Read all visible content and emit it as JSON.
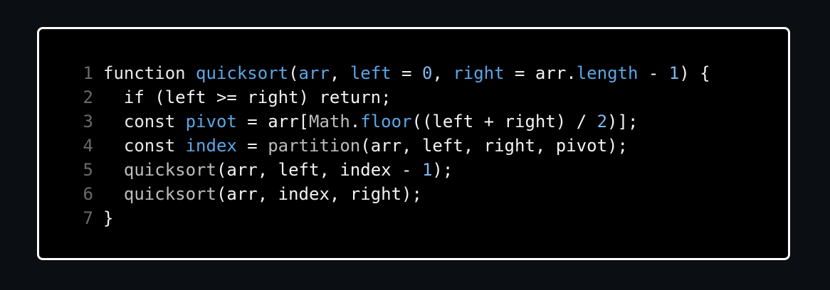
{
  "code_block": {
    "lines": [
      {
        "number": "1",
        "tokens": [
          {
            "text": "function ",
            "kind": "keyword"
          },
          {
            "text": "quicksort",
            "kind": "function"
          },
          {
            "text": "(",
            "kind": "plain"
          },
          {
            "text": "arr",
            "kind": "function"
          },
          {
            "text": ", ",
            "kind": "plain"
          },
          {
            "text": "left",
            "kind": "function"
          },
          {
            "text": " = ",
            "kind": "plain"
          },
          {
            "text": "0",
            "kind": "number"
          },
          {
            "text": ", ",
            "kind": "plain"
          },
          {
            "text": "right",
            "kind": "function"
          },
          {
            "text": " = arr.",
            "kind": "plain"
          },
          {
            "text": "length",
            "kind": "function"
          },
          {
            "text": " - ",
            "kind": "plain"
          },
          {
            "text": "1",
            "kind": "number"
          },
          {
            "text": ") {",
            "kind": "plain"
          }
        ]
      },
      {
        "number": "2",
        "tokens": [
          {
            "text": "  if (left >= right) return;",
            "kind": "plain"
          }
        ]
      },
      {
        "number": "3",
        "tokens": [
          {
            "text": "  const ",
            "kind": "keyword"
          },
          {
            "text": "pivot",
            "kind": "function"
          },
          {
            "text": " = arr[",
            "kind": "plain"
          },
          {
            "text": "Math",
            "kind": "muted"
          },
          {
            "text": ".",
            "kind": "plain"
          },
          {
            "text": "floor",
            "kind": "function"
          },
          {
            "text": "((left + right) / ",
            "kind": "plain"
          },
          {
            "text": "2",
            "kind": "number"
          },
          {
            "text": ")];",
            "kind": "plain"
          }
        ]
      },
      {
        "number": "4",
        "tokens": [
          {
            "text": "  const ",
            "kind": "keyword"
          },
          {
            "text": "index",
            "kind": "function"
          },
          {
            "text": " = ",
            "kind": "plain"
          },
          {
            "text": "partition",
            "kind": "muted"
          },
          {
            "text": "(arr, left, right, pivot);",
            "kind": "plain"
          }
        ]
      },
      {
        "number": "5",
        "tokens": [
          {
            "text": "  ",
            "kind": "plain"
          },
          {
            "text": "quicksort",
            "kind": "muted"
          },
          {
            "text": "(arr, left, index - ",
            "kind": "plain"
          },
          {
            "text": "1",
            "kind": "number"
          },
          {
            "text": ");",
            "kind": "plain"
          }
        ]
      },
      {
        "number": "6",
        "tokens": [
          {
            "text": "  ",
            "kind": "plain"
          },
          {
            "text": "quicksort",
            "kind": "muted"
          },
          {
            "text": "(arr, index, right);",
            "kind": "plain"
          }
        ]
      },
      {
        "number": "7",
        "tokens": [
          {
            "text": "}",
            "kind": "plain"
          }
        ]
      }
    ]
  },
  "colors": {
    "background": "#0b0e12",
    "panel": "#000000",
    "border": "#ffffff",
    "function_blue": "#5aa7e8",
    "number_blue": "#7fb8f0",
    "line_number_gray": "#6a6a6a"
  }
}
